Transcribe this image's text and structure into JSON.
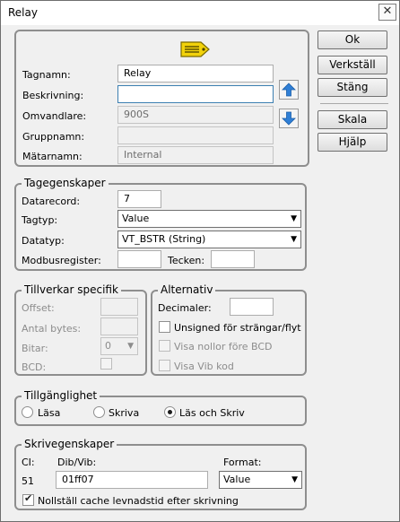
{
  "window": {
    "title": "Relay",
    "close_glyph": "✕"
  },
  "tag": {
    "tagname_label": "Tagnamn:",
    "tagname": "Relay",
    "description_label": "Beskrivning:",
    "description": "",
    "converter_label": "Omvandlare:",
    "converter": "900S",
    "group_label": "Gruppnamn:",
    "group": "",
    "meter_label": "Mätarnamn:",
    "meter": "Internal"
  },
  "buttons": {
    "ok": "Ok",
    "apply": "Verkställ",
    "close": "Stäng",
    "scale": "Skala",
    "help": "Hjälp"
  },
  "tag_properties": {
    "legend": "Tagegenskaper",
    "datarecord_label": "Datarecord:",
    "datarecord": "7",
    "tagtype_label": "Tagtyp:",
    "tagtype": "Value",
    "datatype_label": "Datatyp:",
    "datatype": "VT_BSTR (String)",
    "modbus_label": "Modbusregister:",
    "modbus": "",
    "chars_label": "Tecken:",
    "chars": ""
  },
  "manufacturer": {
    "legend": "Tillverkar specifik",
    "offset_label": "Offset:",
    "offset": "",
    "bytes_label": "Antal bytes:",
    "bytes": "",
    "bits_label": "Bitar:",
    "bits": "0",
    "bcd_label": "BCD:"
  },
  "alternatives": {
    "legend": "Alternativ",
    "decimals_label": "Decimaler:",
    "decimals": "",
    "unsigned_label": "Unsigned för strängar/flyt",
    "zeros_label": "Visa nollor före BCD",
    "vib_label": "Visa Vib kod"
  },
  "access": {
    "legend": "Tillgänglighet",
    "read": "Läsa",
    "write": "Skriva",
    "readwrite": "Läs och Skriv",
    "selected": "readwrite"
  },
  "write_props": {
    "legend": "Skrivegenskaper",
    "ci_label": "CI:",
    "ci": "51",
    "dibvib_label": "Dib/Vib:",
    "dibvib": "01ff07",
    "format_label": "Format:",
    "format": "Value",
    "reset_cache_label": "Nollställ cache levnadstid efter skrivning",
    "reset_cache_checked": true
  },
  "colors": {
    "accent": "#2f7fd6",
    "tag_icon": "#f2d20b"
  },
  "icons": {
    "tag": "tag-icon",
    "up": "arrow-up-icon",
    "down": "arrow-down-icon",
    "dropdown": "chevron-down-icon"
  }
}
